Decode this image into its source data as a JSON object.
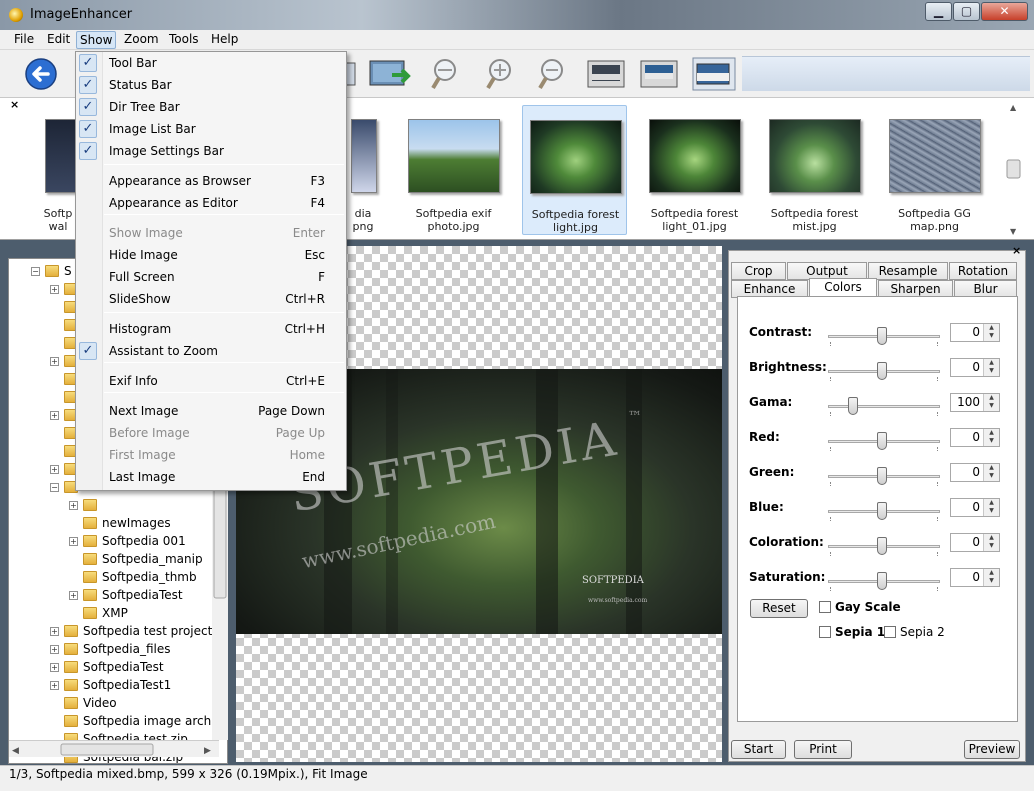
{
  "window": {
    "title": "ImageEnhancer",
    "controls": {
      "minimize": "▁",
      "maximize": "▢",
      "close": "✕"
    }
  },
  "menubar": [
    "File",
    "Edit",
    "Show",
    "Zoom",
    "Tools",
    "Help"
  ],
  "toolbar_icons": [
    "back-arrow-icon",
    "image-icon",
    "export-image-icon",
    "zoom-fit-icon",
    "zoom-in-icon",
    "zoom-out-icon",
    "appearance-browser-icon",
    "appearance-editor-icon",
    "fullscreen-icon"
  ],
  "show_menu": {
    "items": [
      {
        "label": "Tool Bar",
        "shortcut": "",
        "checked": true,
        "enabled": true
      },
      {
        "label": "Status Bar",
        "shortcut": "",
        "checked": true,
        "enabled": true
      },
      {
        "label": "Dir Tree Bar",
        "shortcut": "",
        "checked": true,
        "enabled": true
      },
      {
        "label": "Image List Bar",
        "shortcut": "",
        "checked": true,
        "enabled": true
      },
      {
        "label": "Image Settings Bar",
        "shortcut": "",
        "checked": true,
        "enabled": true
      },
      {
        "label": "Appearance as Browser",
        "shortcut": "F3",
        "checked": false,
        "enabled": true
      },
      {
        "label": "Appearance as Editor",
        "shortcut": "F4",
        "checked": false,
        "enabled": true
      },
      {
        "label": "Show Image",
        "shortcut": "Enter",
        "checked": false,
        "enabled": false
      },
      {
        "label": "Hide Image",
        "shortcut": "Esc",
        "checked": false,
        "enabled": true
      },
      {
        "label": "Full Screen",
        "shortcut": "F",
        "checked": false,
        "enabled": true
      },
      {
        "label": "SlideShow",
        "shortcut": "Ctrl+R",
        "checked": false,
        "enabled": true
      },
      {
        "label": "Histogram",
        "shortcut": "Ctrl+H",
        "checked": false,
        "enabled": true
      },
      {
        "label": "Assistant to Zoom",
        "shortcut": "",
        "checked": true,
        "enabled": true
      },
      {
        "label": "Exif Info",
        "shortcut": "Ctrl+E",
        "checked": false,
        "enabled": true
      },
      {
        "label": "Next Image",
        "shortcut": "Page Down",
        "checked": false,
        "enabled": true
      },
      {
        "label": "Before Image",
        "shortcut": "Page Up",
        "checked": false,
        "enabled": false
      },
      {
        "label": "First Image",
        "shortcut": "Home",
        "checked": false,
        "enabled": false
      },
      {
        "label": "Last Image",
        "shortcut": "End",
        "checked": false,
        "enabled": true
      }
    ]
  },
  "image_list": {
    "close": "×",
    "thumbnails": [
      {
        "line1": "Softp",
        "line2": "wal",
        "selected": false
      },
      {
        "line1": "dia",
        "line2": "png",
        "selected": false
      },
      {
        "line1": "Softpedia exif",
        "line2": "photo.jpg",
        "selected": false
      },
      {
        "line1": "Softpedia forest",
        "line2": "light.jpg",
        "selected": true
      },
      {
        "line1": "Softpedia forest",
        "line2": "light_01.jpg",
        "selected": false
      },
      {
        "line1": "Softpedia forest",
        "line2": "mist.jpg",
        "selected": false
      },
      {
        "line1": "Softpedia GG",
        "line2": "map.png",
        "selected": false
      }
    ]
  },
  "dir_tree": {
    "rows": [
      {
        "label": "S",
        "indent": 0,
        "expander": "-"
      },
      {
        "label": "",
        "indent": 1,
        "expander": "+"
      },
      {
        "label": "",
        "indent": 1,
        "expander": ""
      },
      {
        "label": "",
        "indent": 1,
        "expander": ""
      },
      {
        "label": "",
        "indent": 1,
        "expander": ""
      },
      {
        "label": "",
        "indent": 1,
        "expander": "+"
      },
      {
        "label": "",
        "indent": 1,
        "expander": ""
      },
      {
        "label": "",
        "indent": 1,
        "expander": ""
      },
      {
        "label": "",
        "indent": 1,
        "expander": "+"
      },
      {
        "label": "",
        "indent": 1,
        "expander": ""
      },
      {
        "label": "",
        "indent": 1,
        "expander": ""
      },
      {
        "label": "",
        "indent": 1,
        "expander": "+"
      },
      {
        "label": "",
        "indent": 1,
        "expander": "-"
      },
      {
        "label": "",
        "indent": 2,
        "expander": "+"
      },
      {
        "label": "newImages",
        "indent": 2,
        "expander": ""
      },
      {
        "label": "Softpedia 001",
        "indent": 2,
        "expander": "+"
      },
      {
        "label": "Softpedia_manip",
        "indent": 2,
        "expander": ""
      },
      {
        "label": "Softpedia_thmb",
        "indent": 2,
        "expander": ""
      },
      {
        "label": "SoftpediaTest",
        "indent": 2,
        "expander": "+"
      },
      {
        "label": "XMP",
        "indent": 2,
        "expander": ""
      },
      {
        "label": "Softpedia test project",
        "indent": 1,
        "expander": "+"
      },
      {
        "label": "Softpedia_files",
        "indent": 1,
        "expander": "+"
      },
      {
        "label": "SoftpediaTest",
        "indent": 1,
        "expander": "+"
      },
      {
        "label": "SoftpediaTest1",
        "indent": 1,
        "expander": "+"
      },
      {
        "label": "Video",
        "indent": 1,
        "expander": ""
      },
      {
        "label": "Softpedia image archive",
        "indent": 1,
        "expander": ""
      },
      {
        "label": "Softpedia test.zip",
        "indent": 1,
        "expander": ""
      },
      {
        "label": "Softpedia bal.zip",
        "indent": 1,
        "expander": ""
      }
    ]
  },
  "viewer": {
    "watermark": "SOFTPEDIA",
    "watermark_tm": "™",
    "watermark_url": "www.softpedia.com",
    "logo_small": "SOFTPEDIA",
    "url_small": "www.softpedia.com"
  },
  "settings_panel": {
    "close": "×",
    "tabs_row1": [
      "Crop",
      "Output",
      "Resample",
      "Rotation"
    ],
    "tabs_row2": [
      "Enhance",
      "Colors",
      "Sharpen",
      "Blur"
    ],
    "selected_tab": "Colors",
    "sliders": [
      {
        "label": "Contrast:",
        "value": "0",
        "position": 0.5
      },
      {
        "label": "Brightness:",
        "value": "0",
        "position": 0.5
      },
      {
        "label": "Gama:",
        "value": "100",
        "position": 0.23
      },
      {
        "label": "Red:",
        "value": "0",
        "position": 0.5
      },
      {
        "label": "Green:",
        "value": "0",
        "position": 0.5
      },
      {
        "label": "Blue:",
        "value": "0",
        "position": 0.5
      },
      {
        "label": "Coloration:",
        "value": "0",
        "position": 0.5
      },
      {
        "label": "Saturation:",
        "value": "0",
        "position": 0.5
      }
    ],
    "reset": "Reset",
    "gray_scale": "Gay Scale",
    "sepia1": "Sepia 1",
    "sepia2": "Sepia 2",
    "start": "Start",
    "print": "Print",
    "preview": "Preview"
  },
  "status": "1/3, Softpedia mixed.bmp, 599 x 326 (0.19Mpix.), Fit Image",
  "colors": {
    "accent": "#2f6fc4",
    "selection_bg": "#dcebfb",
    "title_bg": "#8a98a7"
  }
}
